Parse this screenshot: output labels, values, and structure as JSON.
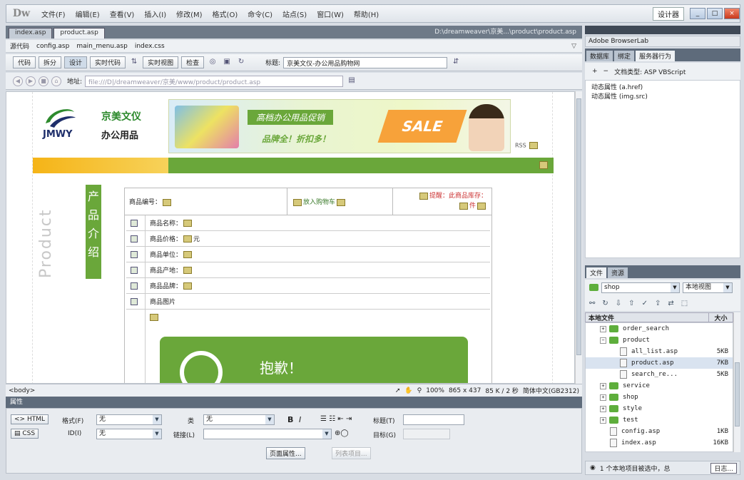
{
  "app": {
    "logo": "Dw",
    "menus": [
      "文件(F)",
      "编辑(E)",
      "查看(V)",
      "插入(I)",
      "修改(M)",
      "格式(O)",
      "命令(C)",
      "站点(S)",
      "窗口(W)",
      "帮助(H)"
    ],
    "workspace": "设计器",
    "window_buttons": [
      "_",
      "□",
      "×"
    ]
  },
  "doc": {
    "tabs": [
      "index.asp",
      "product.asp"
    ],
    "path": "D:\\dreamweaver\\京美...\\product\\product.asp",
    "related_label": "源代码",
    "related_files": [
      "config.asp",
      "main_menu.asp",
      "index.css"
    ],
    "toolbar": {
      "code": "代码",
      "split": "拆分",
      "design": "设计",
      "live_code": "实时代码",
      "live_view": "实时视图",
      "inspect": "检查",
      "title_label": "标题:",
      "title_value": "京美文仪-办公用品购物网"
    },
    "address_label": "地址:",
    "address_value": "file:///D|/dreamweaver/京美/www/product/product.asp"
  },
  "canvas": {
    "logo_word": "JMWY",
    "logo_cn1": "京美文仪",
    "logo_cn2": "办公用品",
    "banner_slogan1": "高档办公用品促销",
    "banner_slogan2": "品牌全！折扣多！",
    "banner_sale": "SALE",
    "rss": "RSS",
    "product_vertical": "Product",
    "intro_vertical": [
      "产",
      "品",
      "介",
      "绍"
    ],
    "detail": {
      "code_label": "商品编号：",
      "cart_label": "放入购物车",
      "tip_line1": "提醒：此商品库存：",
      "tip_line2": "件",
      "fields": [
        "商品名称：",
        "商品价格：",
        "商品单位：",
        "商品产地：",
        "商品品牌：",
        "商品图片"
      ],
      "price_suffix": "元",
      "sorry": "抱歉！"
    }
  },
  "status": {
    "tag": "<body>",
    "zoom": "100%",
    "size": "865 x 437",
    "download": "85 K / 2 秒",
    "encoding": "简体中文(GB2312)"
  },
  "properties": {
    "title": "属性",
    "html_btn": "HTML",
    "css_btn": "CSS",
    "format_label": "格式(F)",
    "format_value": "无",
    "id_label": "ID(I)",
    "id_value": "无",
    "class_label": "类",
    "class_value": "无",
    "link_label": "链接(L)",
    "bold": "B",
    "italic": "I",
    "target_label": "目标(G)",
    "title_label": "标题(T)",
    "page_props_btn": "页面属性...",
    "list_item_btn": "列表项目..."
  },
  "right_panel": {
    "title": "Adobe BrowserLab",
    "tabs1": [
      "数据库",
      "绑定",
      "服务器行为"
    ],
    "tool1": [
      "+",
      "−",
      "文档类型: ASP VBScript"
    ],
    "behaviors": [
      "动态属性 (a.href)",
      "动态属性 (img.src)"
    ],
    "tabs2": [
      "文件",
      "资源"
    ],
    "site": "shop",
    "view": "本地视图",
    "file_header_name": "本地文件",
    "file_header_size": "大小",
    "files": [
      {
        "name": "order_search",
        "type": "folder",
        "indent": 1,
        "exp": "+",
        "size": ""
      },
      {
        "name": "product",
        "type": "folder",
        "indent": 1,
        "exp": "−",
        "size": ""
      },
      {
        "name": "all_list.asp",
        "type": "file",
        "indent": 3,
        "exp": "",
        "size": "5KB"
      },
      {
        "name": "product.asp",
        "type": "file",
        "indent": 3,
        "exp": "",
        "size": "7KB",
        "selected": true
      },
      {
        "name": "search_re...",
        "type": "file",
        "indent": 3,
        "exp": "",
        "size": "5KB"
      },
      {
        "name": "service",
        "type": "folder",
        "indent": 1,
        "exp": "+",
        "size": ""
      },
      {
        "name": "shop",
        "type": "folder",
        "indent": 1,
        "exp": "+",
        "size": ""
      },
      {
        "name": "style",
        "type": "folder",
        "indent": 1,
        "exp": "+",
        "size": ""
      },
      {
        "name": "test",
        "type": "folder",
        "indent": 1,
        "exp": "+",
        "size": ""
      },
      {
        "name": "config.asp",
        "type": "file",
        "indent": 2,
        "exp": "",
        "size": "1KB"
      },
      {
        "name": "index.asp",
        "type": "file",
        "indent": 2,
        "exp": "",
        "size": "16KB"
      }
    ],
    "status_text": "1 个本地项目被选中，总",
    "log_btn": "日志..."
  }
}
